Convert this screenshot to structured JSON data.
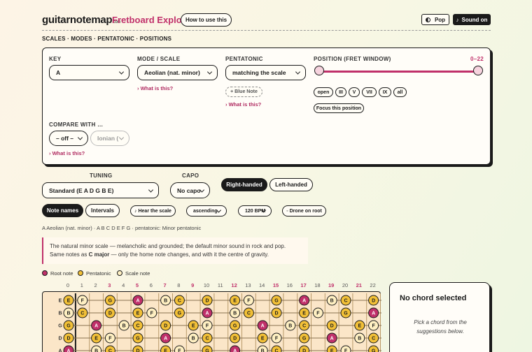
{
  "header": {
    "brand": "guitarn",
    "brand_o": "o",
    "brand_rest": "temap",
    "brand_tld": ".com",
    "title": "Fretboard Explorer",
    "howto_label": "How to use this",
    "pop_label": "Pop",
    "sound_label": "Sound on",
    "pop_icon": "half-circle-icon",
    "sound_icon": "note-icon"
  },
  "breadcrumb": "SCALES · MODES · PENTATONIC · POSITIONS",
  "controls": {
    "key_label": "KEY",
    "key_value": "A",
    "mode_label": "MODE / SCALE",
    "mode_value": "Aeolian (nat. minor)",
    "mode_link": "› What is this?",
    "pent_label": "PENTATONIC",
    "pent_value": "matching the scale",
    "blue_note_label": "+ Blue Note",
    "pent_link": "› What is this?",
    "position_label": "POSITION (FRET WINDOW)",
    "position_range": "0–22",
    "position_min": 0,
    "position_max": 22,
    "position_buttons": [
      "open",
      "III",
      "V",
      "VII",
      "IX",
      "all"
    ],
    "focus_label": "Focus this position",
    "compare_label": "COMPARE WITH …",
    "compare_value": "– off –",
    "compare_mode_value": "Ionian (",
    "compare_link": "› What is this?"
  },
  "tuning": {
    "tuning_label": "TUNING",
    "tuning_value": "Standard (E A D G B E)",
    "capo_label": "CAPO",
    "capo_value": "No capo",
    "right_label": "Right-handed",
    "left_label": "Left-handed"
  },
  "view": {
    "note_names_label": "Note names",
    "intervals_label": "Intervals",
    "hear_label": "♪ Hear the scale",
    "direction_value": "ascending",
    "bpm_value": "120 BPM",
    "drone_label": "◦ Drone on root"
  },
  "summary": "A Aeolian (nat. minor) · A B C D E F G · pentatonic: Minor pentatonic",
  "description_pre": "The natural minor scale — melancholic and grounded; the default minor sound in rock and pop. Same notes as ",
  "description_bold": "C major",
  "description_post": " — only the home note changes, and with it the centre of gravity.",
  "legend": {
    "root": "Root note",
    "pent": "Pentatonic",
    "scale": "Scale note"
  },
  "colors": {
    "root": "#c0306a",
    "pent": "#f2c037",
    "scale": "#fff0c2",
    "accent": "#c0306a"
  },
  "fretboard": {
    "fret_numbers": [
      "0",
      "1",
      "2",
      "3",
      "4",
      "5",
      "6",
      "7",
      "8",
      "9",
      "10",
      "11",
      "12",
      "13",
      "14",
      "15",
      "16",
      "17",
      "18",
      "19",
      "20",
      "21",
      "22"
    ],
    "highlighted_frets": [
      "3",
      "5",
      "7",
      "9",
      "12",
      "15",
      "17",
      "19",
      "21"
    ],
    "strings": [
      {
        "name": "E",
        "notes": [
          "E",
          "F",
          "",
          "G",
          "",
          "A",
          "",
          "B",
          "C",
          "",
          "D",
          "",
          "E",
          "F",
          "",
          "G",
          "",
          "A",
          "",
          "B",
          "C",
          "",
          "D"
        ]
      },
      {
        "name": "B",
        "notes": [
          "B",
          "C",
          "",
          "D",
          "",
          "E",
          "F",
          "",
          "G",
          "",
          "A",
          "",
          "B",
          "C",
          "",
          "D",
          "",
          "E",
          "F",
          "",
          "G",
          "",
          "A"
        ]
      },
      {
        "name": "G",
        "notes": [
          "G",
          "",
          "A",
          "",
          "B",
          "C",
          "",
          "D",
          "",
          "E",
          "F",
          "",
          "G",
          "",
          "A",
          "",
          "B",
          "C",
          "",
          "D",
          "",
          "E",
          "F"
        ]
      },
      {
        "name": "D",
        "notes": [
          "D",
          "",
          "E",
          "F",
          "",
          "G",
          "",
          "A",
          "",
          "B",
          "C",
          "",
          "D",
          "",
          "E",
          "F",
          "",
          "G",
          "",
          "A",
          "",
          "B",
          "C"
        ]
      },
      {
        "name": "A",
        "notes": [
          "A",
          "",
          "B",
          "C",
          "",
          "D",
          "",
          "E",
          "F",
          "",
          "G",
          "",
          "A",
          "",
          "B",
          "C",
          "",
          "D",
          "",
          "E",
          "F",
          "",
          "G"
        ]
      }
    ],
    "pentatonic_notes": [
      "A",
      "C",
      "D",
      "E",
      "G"
    ],
    "root_note": "A"
  },
  "chord": {
    "title": "No chord selected",
    "hint": "Pick a chord from the suggestions below."
  }
}
